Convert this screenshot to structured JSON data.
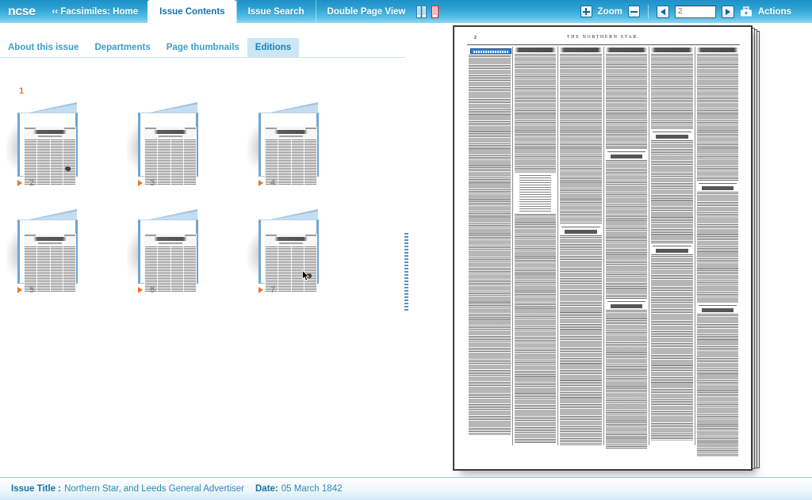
{
  "app": {
    "logo": "ncse",
    "home_link": "‹‹ Facsimiles: Home"
  },
  "nav": {
    "tabs": [
      {
        "label": "Issue Contents",
        "active": true
      },
      {
        "label": "Issue Search",
        "active": false
      },
      {
        "label": "Double Page View",
        "active": false
      }
    ],
    "view_icons": [
      {
        "name": "double-page-view-icon",
        "state": "inactive",
        "color": "#ffffff"
      },
      {
        "name": "single-page-view-icon",
        "state": "active",
        "color": "#e03030"
      }
    ]
  },
  "toolbar": {
    "zoom_label": "Zoom",
    "zoom_in": "+",
    "zoom_out": "−",
    "prev_page": "◀",
    "next_page": "▶",
    "page_input_value": "2",
    "page_input_placeholder": "2",
    "actions_label": "Actions"
  },
  "subtabs": [
    {
      "label": "About this issue",
      "active": false
    },
    {
      "label": "Departments",
      "active": false
    },
    {
      "label": "Page thumbnails",
      "active": false
    },
    {
      "label": "Editions",
      "active": true
    }
  ],
  "editions": {
    "lead_number": "1",
    "items": [
      {
        "number": "2"
      },
      {
        "number": "3"
      },
      {
        "number": "4"
      },
      {
        "number": "5"
      },
      {
        "number": "6"
      },
      {
        "number": "7"
      }
    ]
  },
  "viewer": {
    "page_folio": "2",
    "masthead": "THE NORTHERN STAR.",
    "highlight_caption": "Special Intelligence",
    "stacked_page_count": 4
  },
  "status": {
    "title_key": "Issue Title :",
    "title_value": "Northern Star, and Leeds General Advertiser",
    "date_key": "Date:",
    "date_value": "05 March 1842"
  },
  "colors": {
    "header_blue": "#2fa3d4",
    "accent_orange": "#e8762c",
    "tab_active_bg": "#cbe7f5",
    "link_blue": "#2f89b5"
  }
}
